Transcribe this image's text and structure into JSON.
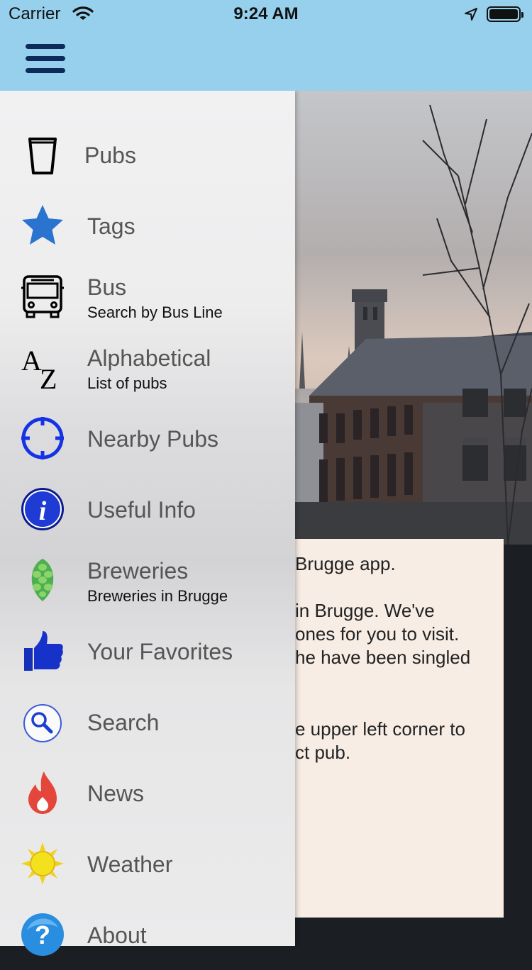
{
  "status_bar": {
    "carrier": "Carrier",
    "time": "9:24 AM"
  },
  "nav": {
    "menu_icon": "hamburger-menu-icon"
  },
  "drawer": {
    "items": [
      {
        "label": "Pubs",
        "subtitle": "",
        "icon": "beer-glass-icon"
      },
      {
        "label": "Tags",
        "subtitle": "",
        "icon": "star-icon"
      },
      {
        "label": "Bus",
        "subtitle": "Search by Bus Line",
        "icon": "bus-icon"
      },
      {
        "label": "Alphabetical",
        "subtitle": "List of pubs",
        "icon": "a-z-icon"
      },
      {
        "label": "Nearby Pubs",
        "subtitle": "",
        "icon": "crosshair-icon"
      },
      {
        "label": "Useful Info",
        "subtitle": "",
        "icon": "info-icon"
      },
      {
        "label": "Breweries",
        "subtitle": "Breweries in Brugge",
        "icon": "hop-icon"
      },
      {
        "label": "Your Favorites",
        "subtitle": "",
        "icon": "thumbs-up-icon"
      },
      {
        "label": "Search",
        "subtitle": "",
        "icon": "magnifier-icon"
      },
      {
        "label": "News",
        "subtitle": "",
        "icon": "flame-icon"
      },
      {
        "label": "Weather",
        "subtitle": "",
        "icon": "sun-icon"
      },
      {
        "label": "About",
        "subtitle": "",
        "icon": "question-icon"
      }
    ]
  },
  "welcome_card": {
    "lines": [
      "Brugge app.",
      "in Brugge. We've",
      "ones for you to visit.",
      "he have been singled",
      "e upper left corner to",
      "ct pub."
    ]
  },
  "colors": {
    "nav_bar": "#96d0ec",
    "hamburger": "#0d2b5a",
    "card_background": "#f7ede5"
  }
}
